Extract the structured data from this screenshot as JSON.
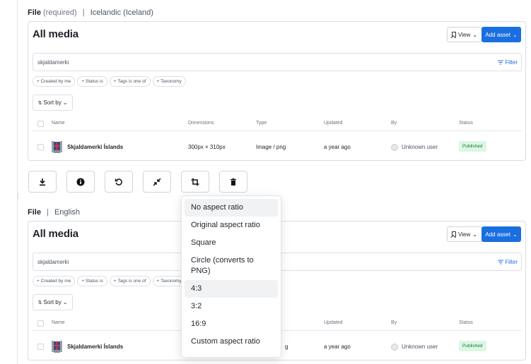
{
  "field1": {
    "label": "File",
    "required": "(required)",
    "separator": "|",
    "language": "Icelandic (Iceland)"
  },
  "field2": {
    "label": "File",
    "separator": "|",
    "language": "English"
  },
  "panel": {
    "title": "All media",
    "view_label": "View",
    "add_label": "Add asset",
    "search_value": "skjaldamerki",
    "filter_label": "Filter",
    "chips": [
      "Created by me",
      "Status is",
      "Tags is one of",
      "Taxonomy"
    ],
    "sort_label": "Sort by",
    "columns": {
      "name": "Name",
      "dimensions": "Dimensions",
      "type": "Type",
      "updated": "Updated",
      "by": "By",
      "status": "Status"
    },
    "row": {
      "name": "Skjaldamerki Íslands",
      "dimensions": "300px × 310px",
      "type": "Image / png",
      "updated": "a year ago",
      "by": "Unknown user",
      "status": "Published"
    }
  },
  "row2_type_fragment": "g",
  "toolbar": {
    "buttons": [
      "download-icon",
      "info-icon",
      "reset-icon",
      "minimize-icon",
      "crop-icon",
      "trash-icon"
    ]
  },
  "dropdown": {
    "items": [
      "No aspect ratio",
      "Original aspect ratio",
      "Square",
      "Circle (converts to PNG)",
      "4:3",
      "3:2",
      "16:9",
      "Custom aspect ratio"
    ]
  },
  "colors": {
    "accent": "#1a6fe0",
    "published_bg": "#dcf7e3",
    "published_fg": "#1c7a3c"
  }
}
